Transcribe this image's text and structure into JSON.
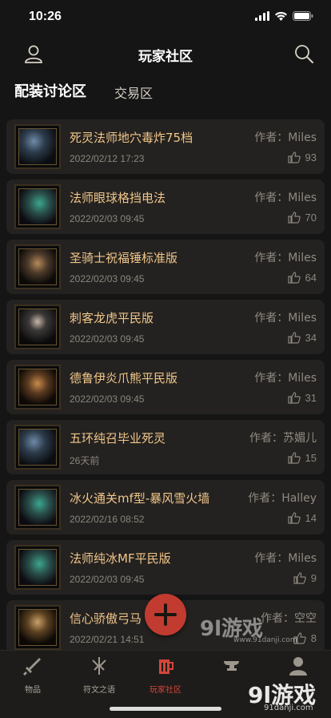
{
  "status_bar": {
    "time": "10:26"
  },
  "header": {
    "title": "玩家社区"
  },
  "tabs": [
    {
      "label": "配装讨论区",
      "active": true
    },
    {
      "label": "交易区",
      "active": false
    }
  ],
  "posts": [
    {
      "title": "死灵法师地穴毒炸75档",
      "author": "作者：Miles",
      "date": "2022/02/12 17:23",
      "likes": "93"
    },
    {
      "title": "法师眼球格挡电法",
      "author": "作者：Miles",
      "date": "2022/02/03 09:45",
      "likes": "70"
    },
    {
      "title": "圣骑士祝福锤标准版",
      "author": "作者：Miles",
      "date": "2022/02/03 09:45",
      "likes": "64"
    },
    {
      "title": "刺客龙虎平民版",
      "author": "作者：Miles",
      "date": "2022/02/03 09:45",
      "likes": "34"
    },
    {
      "title": "德鲁伊炎爪熊平民版",
      "author": "作者：Miles",
      "date": "2022/02/03 09:45",
      "likes": "31"
    },
    {
      "title": "五环纯召毕业死灵",
      "author": "作者：苏媚儿",
      "date": "26天前",
      "likes": "15"
    },
    {
      "title": "冰火通关mf型-暴风雪火墙",
      "author": "作者：Halley",
      "date": "2022/02/16 08:52",
      "likes": "14"
    },
    {
      "title": "法师纯冰MF平民版",
      "author": "作者：Miles",
      "date": "2022/02/03 09:45",
      "likes": "9"
    },
    {
      "title": "信心骄傲弓马",
      "author": "作者：空空",
      "date": "2022/02/21 14:51",
      "likes": "8"
    }
  ],
  "tabbar": [
    {
      "label": "物品",
      "icon": "sword-icon",
      "active": false
    },
    {
      "label": "符文之语",
      "icon": "rune-icon",
      "active": false
    },
    {
      "label": "玩家社区",
      "icon": "mug-icon",
      "active": true
    },
    {
      "label": "",
      "icon": "anvil-icon",
      "active": false
    },
    {
      "label": "",
      "icon": "profile-icon",
      "active": false
    }
  ],
  "watermark": {
    "logo_mid": "9l游戏",
    "url_mid": "www.91danji.com",
    "logo_bottom": "9l游戏",
    "url_bottom": "91danji.com"
  },
  "colors": {
    "accent": "#c83a33",
    "title": "#f0c68a",
    "card_bg": "#242220",
    "background": "#151515"
  }
}
